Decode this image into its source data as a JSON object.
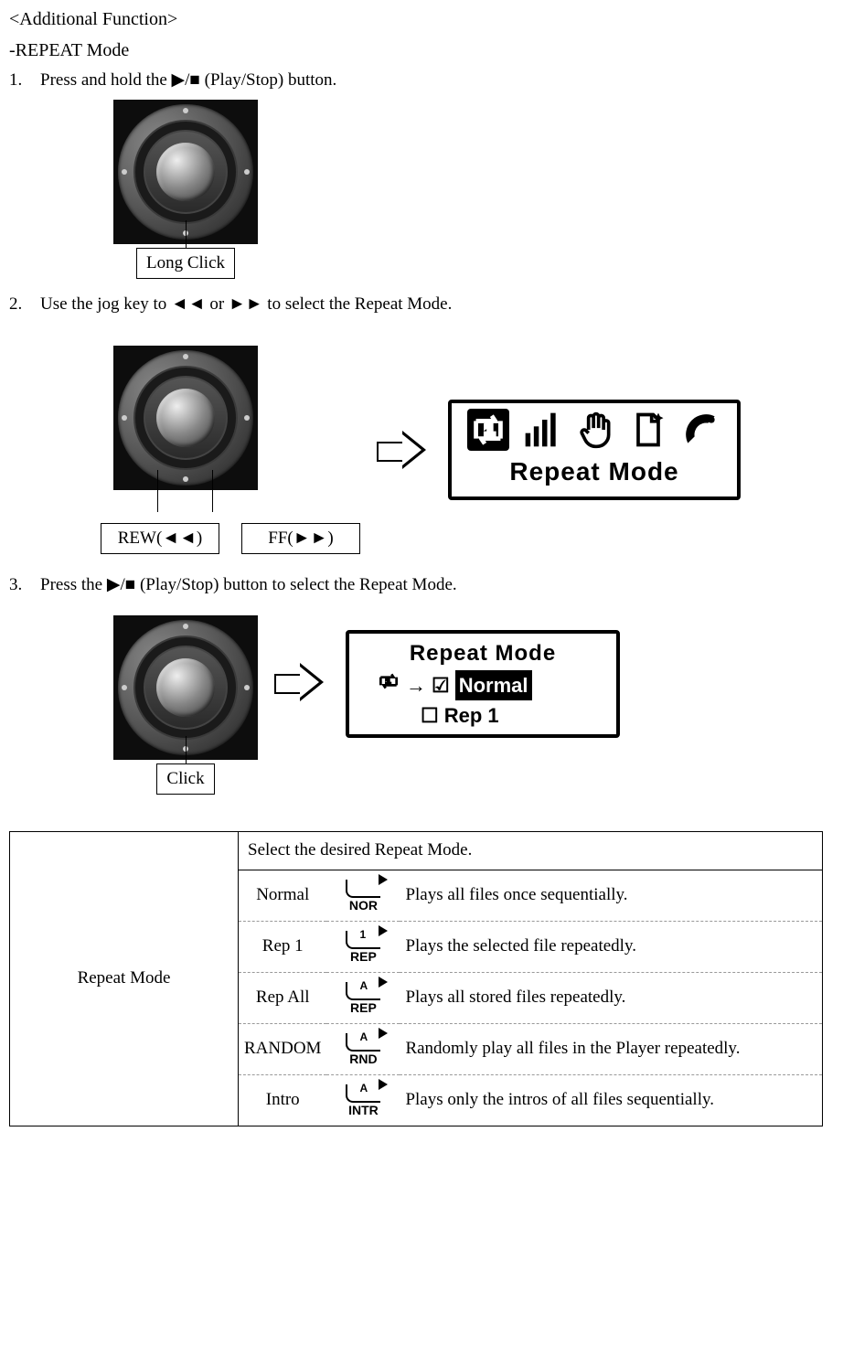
{
  "title1": "<Additional Function>",
  "title2": "-REPEAT Mode",
  "step1": {
    "num": "1.",
    "text": "Press and hold the ▶/■ (Play/Stop) button."
  },
  "longClick": "Long Click",
  "step2": {
    "num": "2.",
    "text": "Use the jog key to ◄◄ or ►► to select the Repeat Mode."
  },
  "rewLabel": "REW(◄◄)",
  "ffLabel": "FF(►►)",
  "screenRepeatMode": "Repeat Mode",
  "step3": {
    "num": "3.",
    "text": "Press the ▶/■ (Play/Stop) button to select the Repeat Mode."
  },
  "clickLabel": "Click",
  "screen2": {
    "title": "Repeat Mode",
    "opt1": "Normal",
    "opt2": "Rep 1"
  },
  "table": {
    "main": "Repeat Mode",
    "header": "Select the desired Repeat Mode.",
    "rows": [
      {
        "name": "Normal",
        "iconSub": "NOR",
        "iconLetter": "",
        "desc": "Plays all files once sequentially."
      },
      {
        "name": "Rep 1",
        "iconSub": "REP",
        "iconLetter": "1",
        "desc": "Plays the selected file repeatedly."
      },
      {
        "name": "Rep All",
        "iconSub": "REP",
        "iconLetter": "A",
        "desc": "Plays all stored files repeatedly."
      },
      {
        "name": "RANDOM",
        "iconSub": "RND",
        "iconLetter": "A",
        "desc": "Randomly play all files in the Player repeatedly."
      },
      {
        "name": "Intro",
        "iconSub": "INTR",
        "iconLetter": "A",
        "desc": "Plays only the intros of all files sequentially."
      }
    ]
  }
}
